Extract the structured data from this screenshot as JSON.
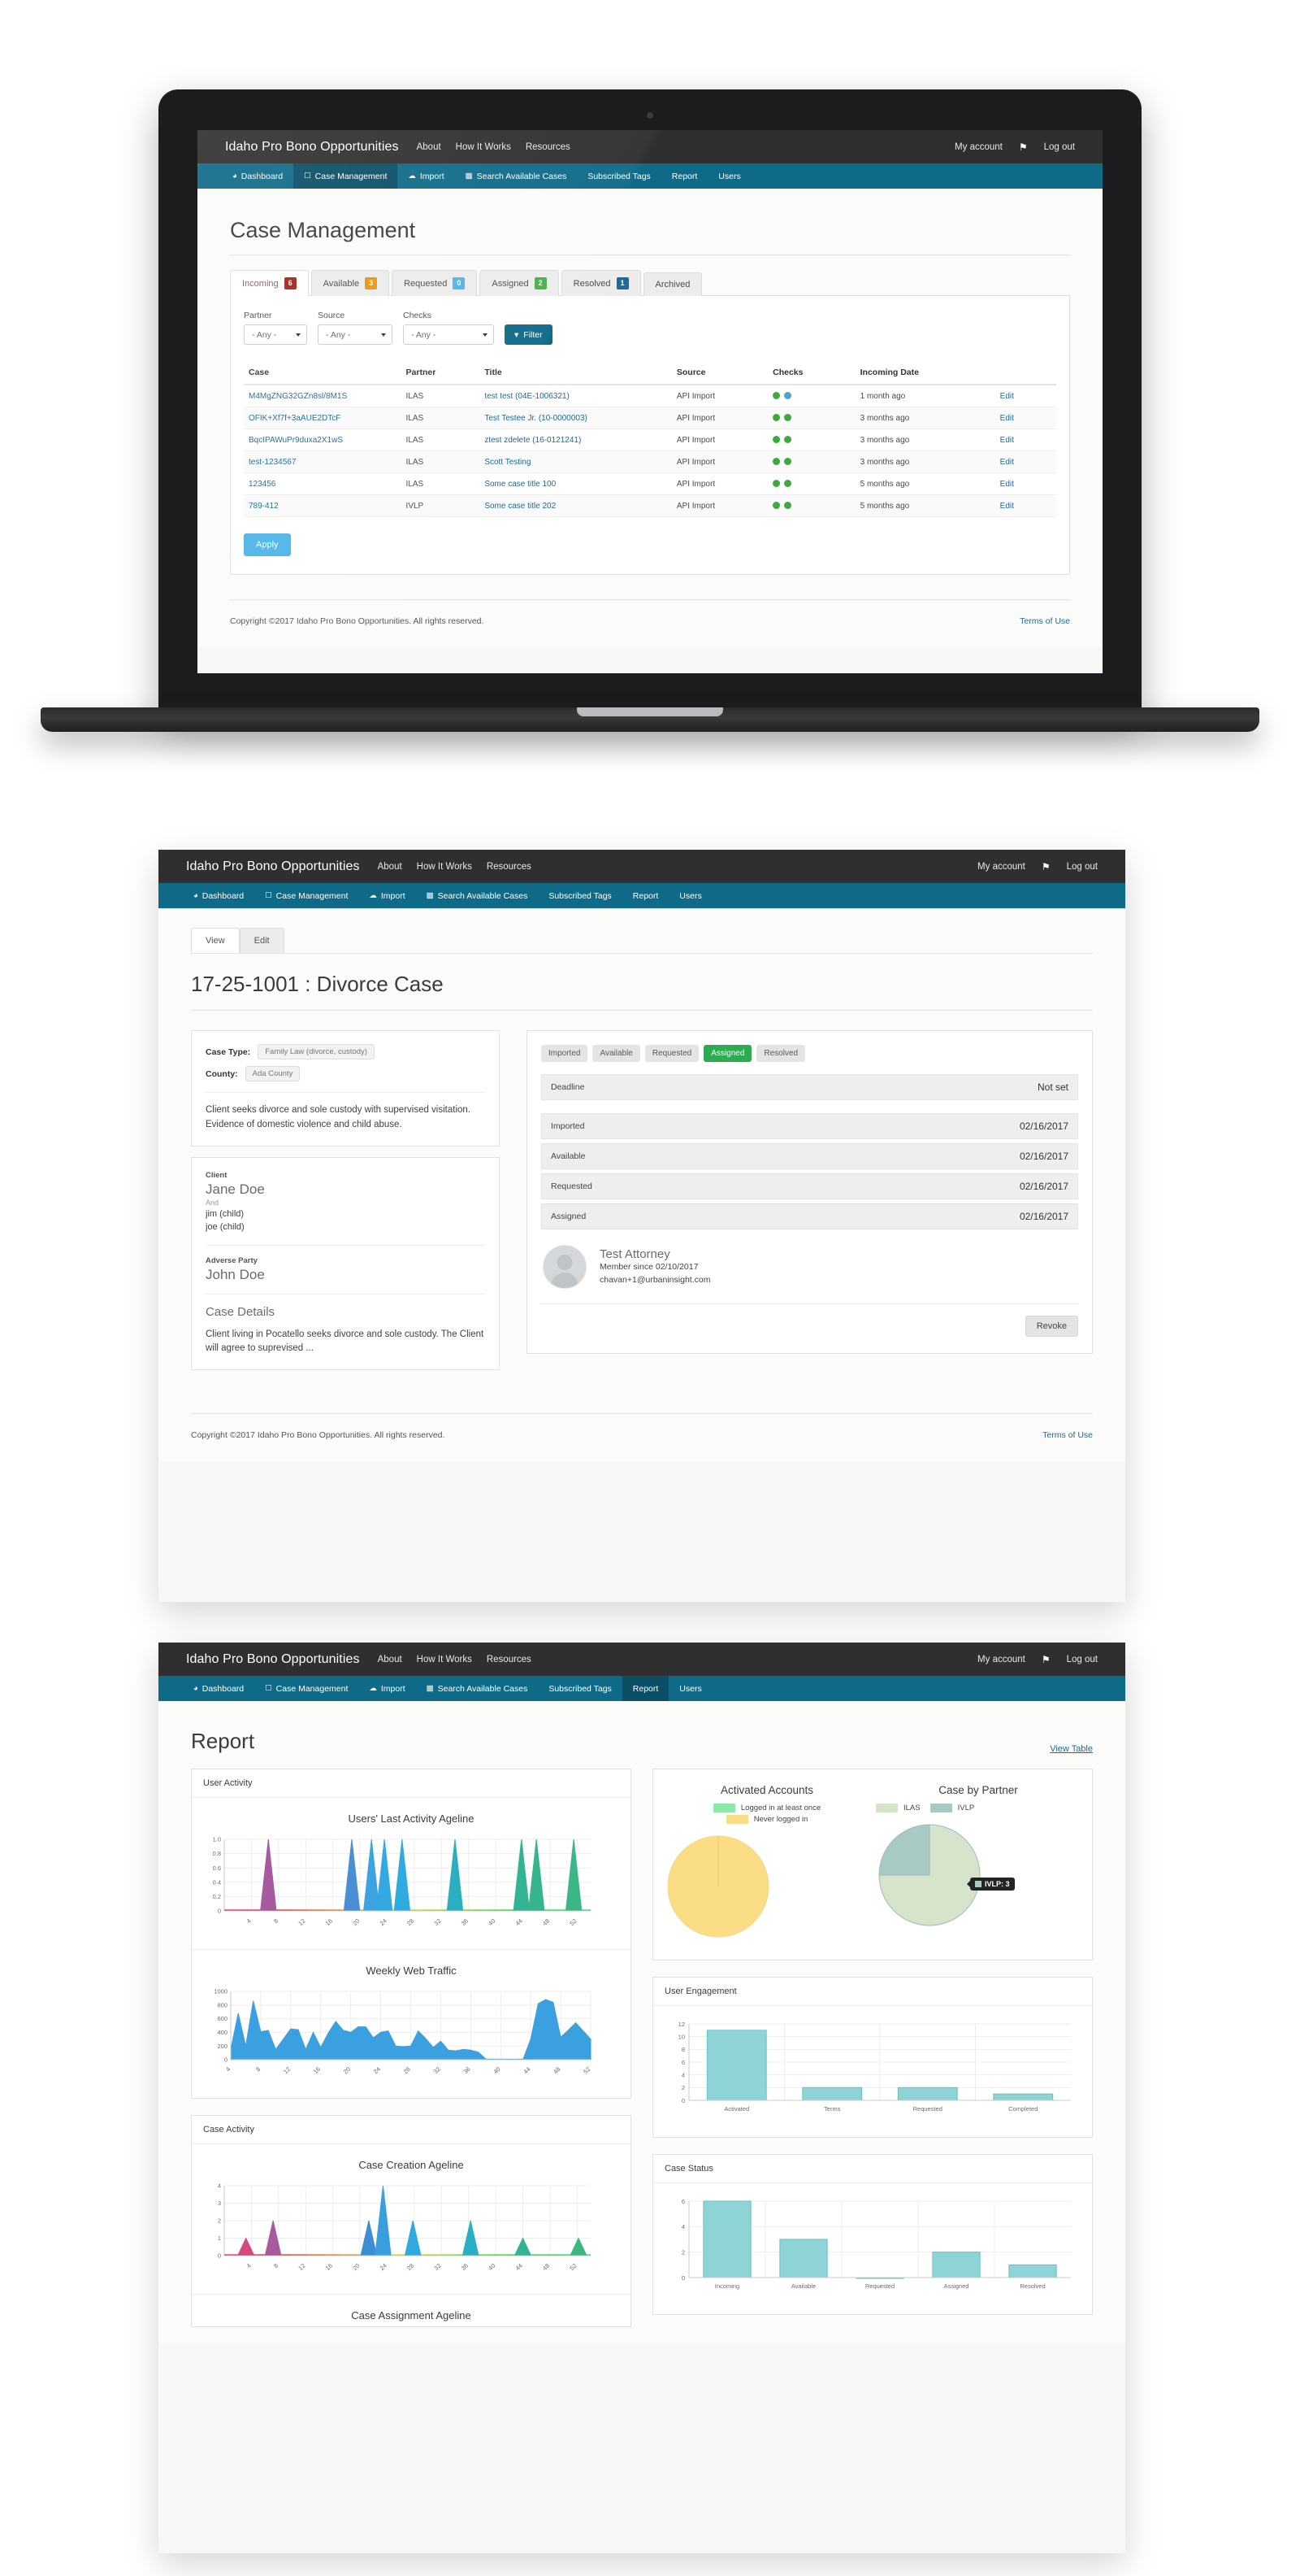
{
  "site": {
    "brand": "Idaho Pro Bono Opportunities",
    "top_links": [
      "About",
      "How It Works",
      "Resources"
    ],
    "account_label": "My account",
    "bell_icon": "bell-icon",
    "logout_label": "Log out",
    "nav": [
      {
        "label": "Dashboard",
        "icon": "dashboard-icon",
        "glyph": "⌘"
      },
      {
        "label": "Case Management",
        "icon": "briefcase-icon",
        "glyph": "⌸"
      },
      {
        "label": "Import",
        "icon": "upload-cloud-icon",
        "glyph": "⛅"
      },
      {
        "label": "Search Available Cases",
        "icon": "bar-chart-icon",
        "glyph": "█"
      },
      {
        "label": "Subscribed Tags",
        "icon": "",
        "glyph": ""
      },
      {
        "label": "Report",
        "icon": "",
        "glyph": ""
      },
      {
        "label": "Users",
        "icon": "",
        "glyph": ""
      }
    ],
    "footer": {
      "copyright": "Copyright ©2017 Idaho Pro Bono Opportunities. All rights reserved.",
      "terms": "Terms of Use"
    },
    "colors": {
      "topbar": "#2f2f2f",
      "navbar": "#0f6a88",
      "nav_active": "#0a4f66",
      "link": "#1a6a9a",
      "apply_button": "#4db5e8",
      "filter_button": "#0f6a88",
      "assigned_green": "#2cab50"
    }
  },
  "case_management": {
    "page_title": "Case Management",
    "active_nav": "Case Management",
    "tabs": [
      {
        "label": "Incoming",
        "count": "6",
        "color": "#a4241c",
        "active": true
      },
      {
        "label": "Available",
        "count": "3",
        "color": "#e8980c",
        "active": false
      },
      {
        "label": "Requested",
        "count": "0",
        "color": "#4db5e8",
        "active": false
      },
      {
        "label": "Assigned",
        "count": "2",
        "color": "#46b04a",
        "active": false
      },
      {
        "label": "Resolved",
        "count": "1",
        "color": "#1a6a9a",
        "active": false
      },
      {
        "label": "Archived",
        "count": "",
        "color": "",
        "active": false
      }
    ],
    "filters": [
      {
        "label": "Partner",
        "value": "- Any -"
      },
      {
        "label": "Source",
        "value": "- Any -"
      },
      {
        "label": "Checks",
        "value": "- Any -"
      }
    ],
    "filter_button": "Filter",
    "apply_button": "Apply",
    "table": {
      "headers": [
        "Case",
        "Partner",
        "Title",
        "Source",
        "Checks",
        "Incoming Date",
        ""
      ],
      "rows": [
        {
          "case": "M4MgZNG32GZn8sl/8M1S",
          "partner": "ILAS",
          "title": "test test (04E-1006321)",
          "source": "API Import",
          "checks": [
            "green",
            "blue"
          ],
          "date": "1 month ago",
          "edit": "Edit"
        },
        {
          "case": "OFIK+Xf7f+3aAUE2DTcF",
          "partner": "ILAS",
          "title": "Test Testee Jr. (10-0000003)",
          "source": "API Import",
          "checks": [
            "green",
            "green"
          ],
          "date": "3 months ago",
          "edit": "Edit"
        },
        {
          "case": "BqcIPAWuPr9duxa2X1wS",
          "partner": "ILAS",
          "title": "ztest zdelete (16-0121241)",
          "source": "API Import",
          "checks": [
            "green",
            "green"
          ],
          "date": "3 months ago",
          "edit": "Edit"
        },
        {
          "case": "test-1234567",
          "partner": "ILAS",
          "title": "Scott Testing",
          "source": "API Import",
          "checks": [
            "green",
            "green"
          ],
          "date": "3 months ago",
          "edit": "Edit"
        },
        {
          "case": "123456",
          "partner": "ILAS",
          "title": "Some case title 100",
          "source": "API Import",
          "checks": [
            "green",
            "green"
          ],
          "date": "5 months ago",
          "edit": "Edit"
        },
        {
          "case": "789-412",
          "partner": "IVLP",
          "title": "Some case title 202",
          "source": "API Import",
          "checks": [
            "green",
            "green"
          ],
          "date": "5 months ago",
          "edit": "Edit"
        }
      ]
    }
  },
  "case_detail": {
    "active_nav": "Case Management",
    "view_tabs": [
      {
        "label": "View",
        "active": true
      },
      {
        "label": "Edit",
        "active": false
      }
    ],
    "page_title": "17-25-1001 : Divorce Case",
    "case_type_label": "Case Type:",
    "case_type_value": "Family Law (divorce, custody)",
    "county_label": "County:",
    "county_value": "Ada County",
    "summary": "Client seeks divorce and sole custody with supervised visitation. Evidence of domestic violence and child abuse.",
    "client_label": "Client",
    "client_name": "Jane Doe",
    "and_label": "And",
    "client_others": [
      "jim (child)",
      "joe (child)"
    ],
    "adverse_label": "Adverse Party",
    "adverse_name": "John Doe",
    "details_heading": "Case Details",
    "details_text": "Client living in Pocatello seeks divorce and sole custody.  The Client will agree to suprevised ...",
    "status_chips": [
      {
        "label": "Imported",
        "active": false
      },
      {
        "label": "Available",
        "active": false
      },
      {
        "label": "Requested",
        "active": false
      },
      {
        "label": "Assigned",
        "active": true
      },
      {
        "label": "Resolved",
        "active": false
      }
    ],
    "deadline_label": "Deadline",
    "deadline_value": "Not set",
    "status_rows": [
      {
        "label": "Imported",
        "date": "02/16/2017"
      },
      {
        "label": "Available",
        "date": "02/16/2017"
      },
      {
        "label": "Requested",
        "date": "02/16/2017"
      },
      {
        "label": "Assigned",
        "date": "02/16/2017"
      }
    ],
    "assignee": {
      "avatar_icon": "user-avatar-placeholder-icon",
      "name": "Test Attorney",
      "member_since": "Member since 02/10/2017",
      "email": "chavan+1@urbaninsight.com"
    },
    "revoke_button": "Revoke"
  },
  "report": {
    "active_nav": "Report",
    "page_title": "Report",
    "view_table_link": "View Table",
    "cards": {
      "user_activity": "User Activity",
      "case_activity": "Case Activity",
      "user_engagement": "User Engagement",
      "case_status": "Case Status"
    }
  },
  "chart_data": [
    {
      "type": "area",
      "title": "Users' Last Activity Ageline",
      "xlabel": "",
      "ylabel": "",
      "xlim": [
        0,
        54
      ],
      "ylim": [
        0,
        1.0
      ],
      "yticks": [
        "0",
        "0.2",
        "0.4",
        "0.6",
        "0.8",
        "1.0"
      ],
      "xticks": [
        "4",
        "8",
        "12",
        "16",
        "20",
        "24",
        "28",
        "32",
        "36",
        "40",
        "44",
        "48",
        "52"
      ],
      "grid": true,
      "peaks": [
        {
          "x": 6.5,
          "y": 1.0,
          "color": "#a85a9e"
        },
        {
          "x": 18.8,
          "y": 1.0,
          "color": "#4a8fd4"
        },
        {
          "x": 21.7,
          "y": 1.0,
          "color": "#3aa3e0"
        },
        {
          "x": 23.6,
          "y": 1.0,
          "color": "#34a8e0"
        },
        {
          "x": 26.2,
          "y": 1.0,
          "color": "#2fabdf"
        },
        {
          "x": 34.0,
          "y": 1.0,
          "color": "#2aaec0"
        },
        {
          "x": 43.8,
          "y": 1.0,
          "color": "#34b394"
        },
        {
          "x": 46.0,
          "y": 1.0,
          "color": "#36b48e"
        },
        {
          "x": 51.5,
          "y": 1.0,
          "color": "#3bb684"
        }
      ]
    },
    {
      "type": "area",
      "title": "Weekly Web Traffic",
      "xlabel": "",
      "ylabel": "",
      "ylim": [
        0,
        1000
      ],
      "yticks": [
        "0",
        "200",
        "400",
        "600",
        "800",
        "1000"
      ],
      "color": "#3aa0e0",
      "grid": true,
      "values": [
        150,
        680,
        200,
        860,
        410,
        430,
        150,
        300,
        450,
        440,
        150,
        400,
        180,
        390,
        560,
        430,
        400,
        480,
        480,
        320,
        400,
        420,
        200,
        190,
        200,
        420,
        310,
        180,
        270,
        140,
        130,
        150,
        140,
        110,
        10,
        8,
        8,
        8,
        8,
        10,
        300,
        820,
        880,
        840,
        330,
        430,
        540,
        420,
        300
      ]
    },
    {
      "type": "pie",
      "title": "Activated Accounts",
      "legend": [
        "Logged in at least once",
        "Never logged in"
      ],
      "legend_position": "top",
      "labels": [
        "Logged in at least once",
        "Never logged in"
      ],
      "values": [
        0,
        100
      ],
      "colors": [
        "#8ee8a8",
        "#fbdd85"
      ]
    },
    {
      "type": "pie",
      "title": "Case by Partner",
      "legend": [
        "ILAS",
        "IVLP"
      ],
      "legend_position": "top",
      "labels": [
        "ILAS",
        "IVLP"
      ],
      "values": [
        9,
        3
      ],
      "colors": [
        "#d6e4cb",
        "#a9c9c4"
      ],
      "annotation": "IVLP: 3"
    },
    {
      "type": "bar",
      "title": "User Engagement",
      "categories": [
        "Activated",
        "Terms",
        "Requested",
        "Completed"
      ],
      "values": [
        11,
        2,
        2,
        1
      ],
      "ylim": [
        0,
        12
      ],
      "yticks": [
        "0",
        "2",
        "4",
        "6",
        "8",
        "10",
        "12"
      ],
      "color": "#8ed3d5",
      "grid": true
    },
    {
      "type": "area",
      "title": "Case Creation Ageline",
      "xlim": [
        0,
        54
      ],
      "ylim": [
        0,
        4
      ],
      "yticks": [
        "0",
        "1",
        "2",
        "3",
        "4"
      ],
      "xticks": [
        "4",
        "8",
        "12",
        "16",
        "20",
        "24",
        "28",
        "32",
        "36",
        "40",
        "44",
        "48",
        "52"
      ],
      "grid": true,
      "peaks": [
        {
          "x": 3.2,
          "y": 1.0,
          "color": "#d44a7e"
        },
        {
          "x": 7.2,
          "y": 2.0,
          "color": "#a85a9e"
        },
        {
          "x": 21.3,
          "y": 2.0,
          "color": "#3f8ed4"
        },
        {
          "x": 23.4,
          "y": 4.0,
          "color": "#3a9ddc"
        },
        {
          "x": 27.8,
          "y": 2.0,
          "color": "#2fa9de"
        },
        {
          "x": 36.3,
          "y": 2.0,
          "color": "#2bafc4"
        },
        {
          "x": 44.0,
          "y": 1.0,
          "color": "#33b396"
        },
        {
          "x": 52.2,
          "y": 1.0,
          "color": "#3cb781"
        }
      ]
    },
    {
      "type": "area",
      "title": "Case Assignment Ageline",
      "xlim": [
        0,
        54
      ],
      "ylim": [
        0,
        4
      ],
      "grid": true,
      "peaks": []
    },
    {
      "type": "bar",
      "title": "Case Status",
      "categories": [
        "Incoming",
        "Available",
        "Requested",
        "Assigned",
        "Resolved"
      ],
      "values": [
        6,
        3,
        0,
        2,
        1
      ],
      "ylim": [
        0,
        6
      ],
      "yticks": [
        "0",
        "2",
        "4",
        "6"
      ],
      "color": "#8ed3d5",
      "grid": true
    }
  ]
}
